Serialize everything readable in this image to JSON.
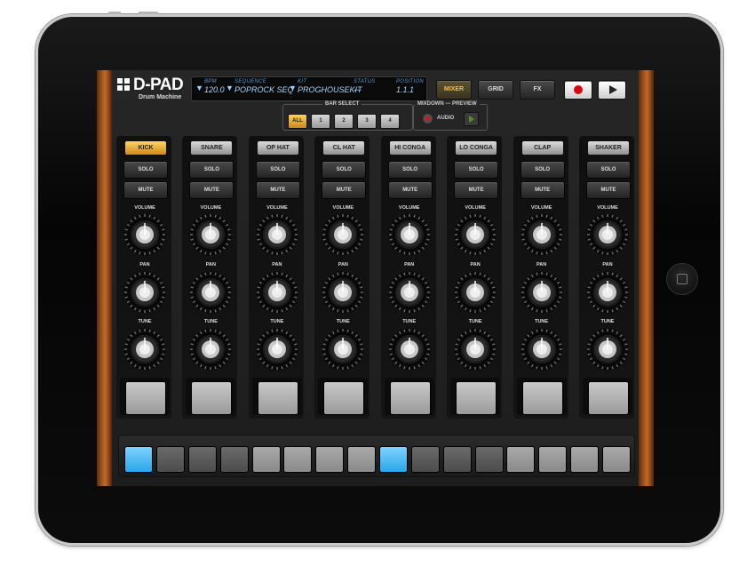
{
  "app": {
    "logo_title": "D-PAD",
    "logo_subtitle": "Drum Machine"
  },
  "lcd": {
    "bpm_label": "BPM",
    "bpm_value": "120.0",
    "sequence_label": "SEQUENCE",
    "sequence_value": "POPROCK SEQ",
    "kit_label": "KIT",
    "kit_value": "PROGHOUSEKIT",
    "status_label": "STATUS",
    "status_value": "---",
    "position_label": "POSITION",
    "position_value": "1.1.1"
  },
  "toolbar": {
    "mixer_label": "MIXER",
    "grid_label": "GRID",
    "fx_label": "FX",
    "record_icon": "record-icon",
    "play_icon": "play-icon"
  },
  "bar_select": {
    "label": "BAR SELECT",
    "options": [
      "ALL",
      "1",
      "2",
      "3",
      "4"
    ],
    "selected": "ALL"
  },
  "mixdown_preview": {
    "label": "MIXDOWN --- PREVIEW",
    "audio_label": "AUDIO"
  },
  "channels": [
    {
      "name": "KICK",
      "active": true,
      "solo": "SOLO",
      "mute": "MUTE",
      "volume_label": "VOLUME",
      "pan_label": "PAN",
      "tune_label": "TUNE"
    },
    {
      "name": "SNARE",
      "active": false,
      "solo": "SOLO",
      "mute": "MUTE",
      "volume_label": "VOLUME",
      "pan_label": "PAN",
      "tune_label": "TUNE"
    },
    {
      "name": "OP HAT",
      "active": false,
      "solo": "SOLO",
      "mute": "MUTE",
      "volume_label": "VOLUME",
      "pan_label": "PAN",
      "tune_label": "TUNE"
    },
    {
      "name": "CL HAT",
      "active": false,
      "solo": "SOLO",
      "mute": "MUTE",
      "volume_label": "VOLUME",
      "pan_label": "PAN",
      "tune_label": "TUNE"
    },
    {
      "name": "HI CONGA",
      "active": false,
      "solo": "SOLO",
      "mute": "MUTE",
      "volume_label": "VOLUME",
      "pan_label": "PAN",
      "tune_label": "TUNE"
    },
    {
      "name": "LO CONGA",
      "active": false,
      "solo": "SOLO",
      "mute": "MUTE",
      "volume_label": "VOLUME",
      "pan_label": "PAN",
      "tune_label": "TUNE"
    },
    {
      "name": "CLAP",
      "active": false,
      "solo": "SOLO",
      "mute": "MUTE",
      "volume_label": "VOLUME",
      "pan_label": "PAN",
      "tune_label": "TUNE"
    },
    {
      "name": "SHAKER",
      "active": false,
      "solo": "SOLO",
      "mute": "MUTE",
      "volume_label": "VOLUME",
      "pan_label": "PAN",
      "tune_label": "TUNE"
    }
  ],
  "sequencer": {
    "steps": [
      "lit",
      "dark",
      "dark",
      "dark",
      "off",
      "off",
      "off",
      "off",
      "lit",
      "dark",
      "dark",
      "dark",
      "off",
      "off",
      "off",
      "off"
    ]
  },
  "colors": {
    "accent_orange": "#e8a630",
    "step_lit": "#3fb2f0",
    "lcd_text": "#8fc6ff",
    "record_red": "#d60a12"
  }
}
